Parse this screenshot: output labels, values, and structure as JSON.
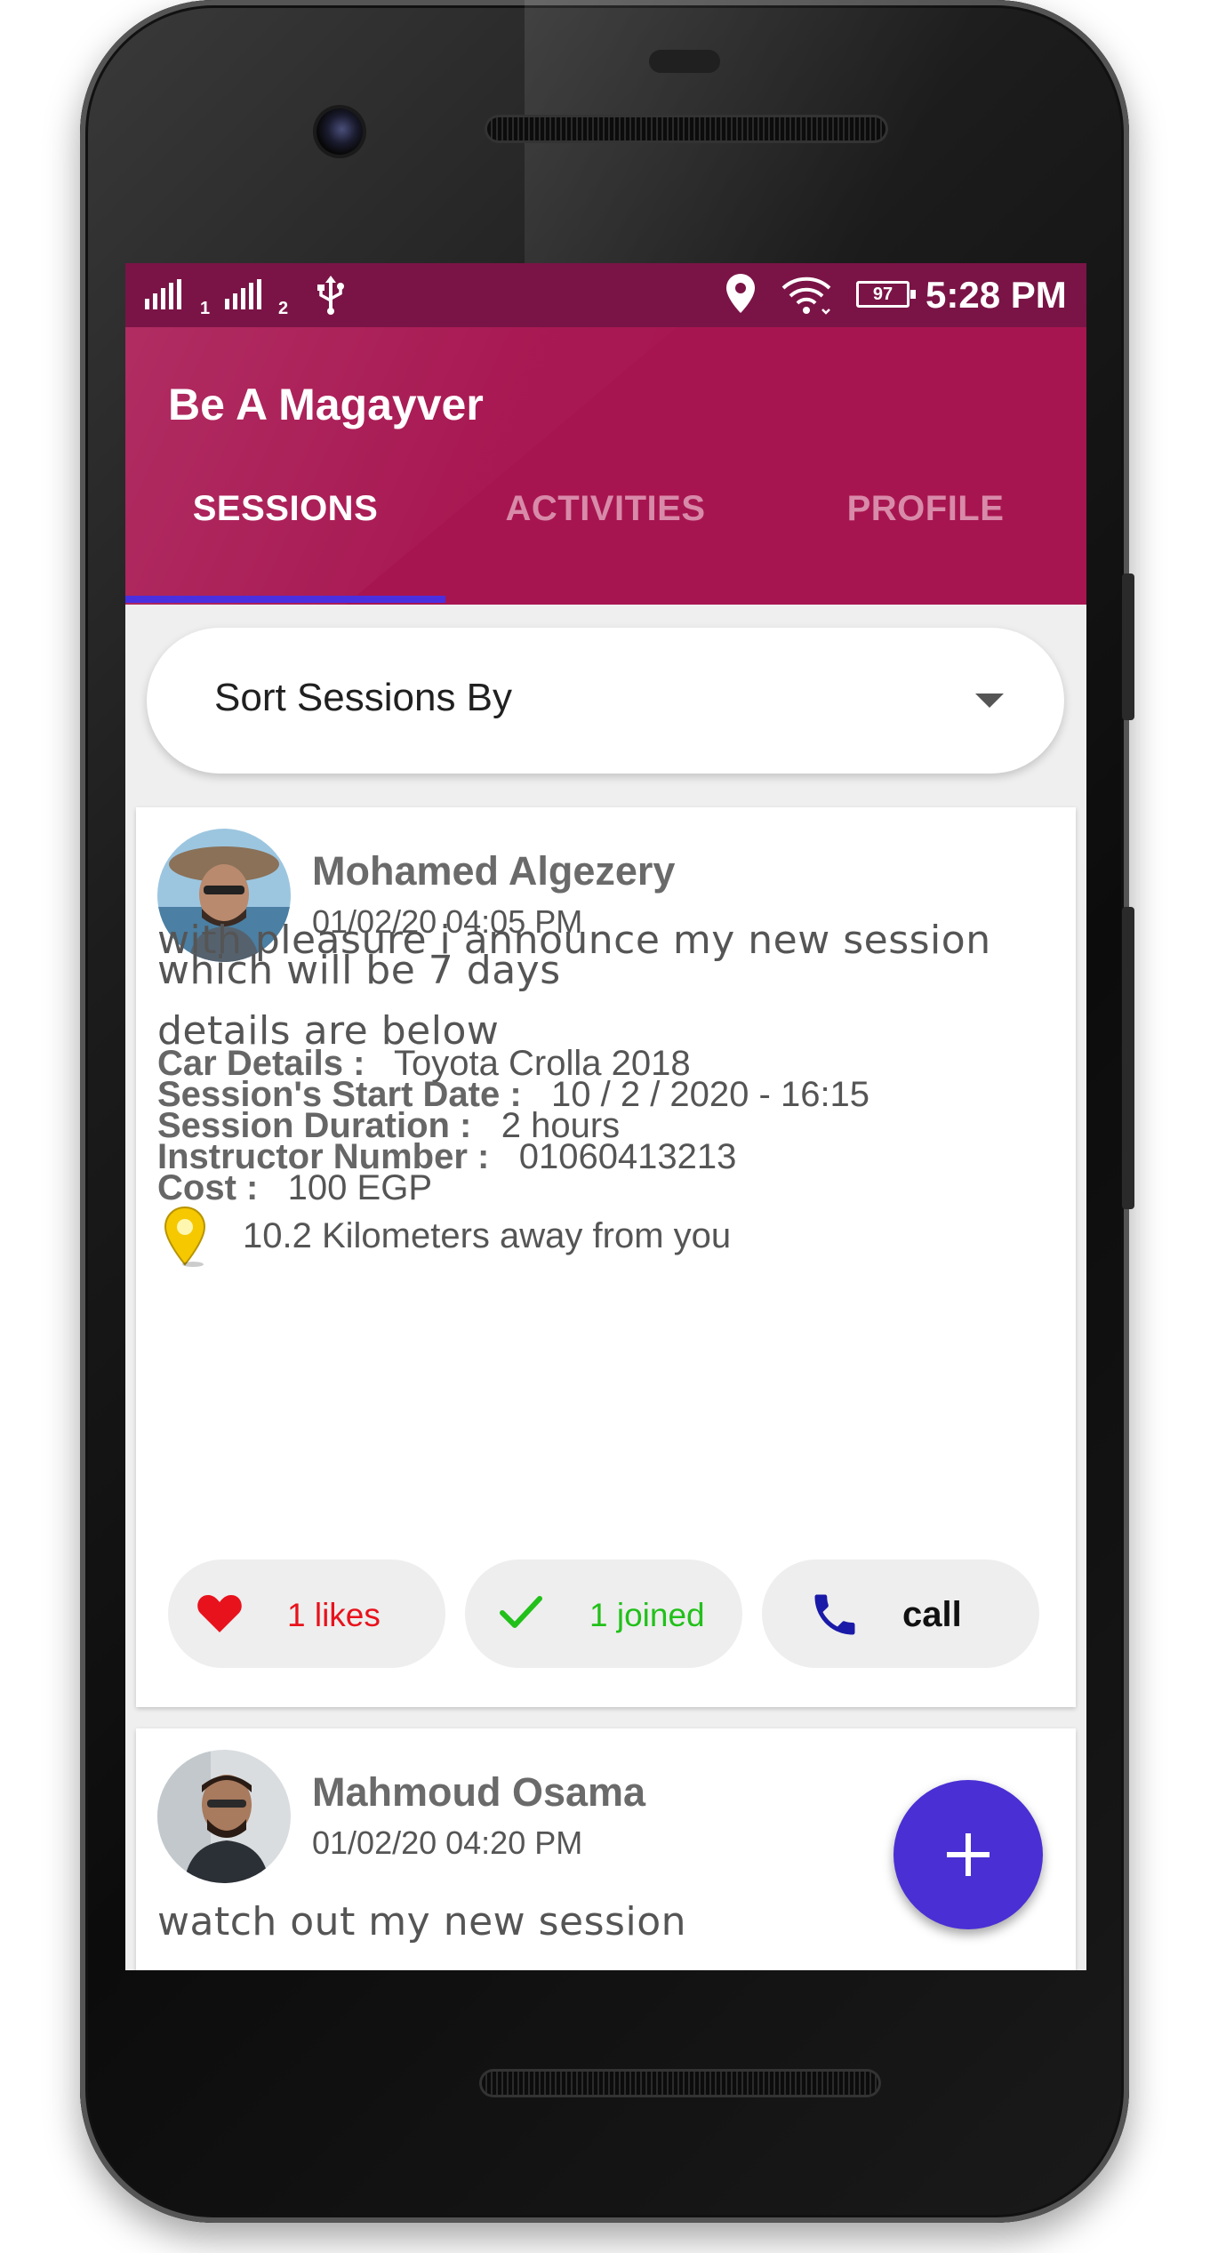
{
  "status_bar": {
    "sim1_index": "1",
    "sim2_index": "2",
    "battery": "97",
    "time": "5:28 PM"
  },
  "app": {
    "title": "Be A Magayver"
  },
  "tabs": [
    {
      "label": "SESSIONS",
      "active": true
    },
    {
      "label": "ACTIVITIES",
      "active": false
    },
    {
      "label": "PROFILE",
      "active": false
    }
  ],
  "sort": {
    "label": "Sort Sessions By"
  },
  "posts": [
    {
      "author": "Mohamed Algezery",
      "date": "01/02/20 04:05 PM",
      "body_line1": "with pleasure i announce my new session",
      "body_line2": "which will be 7 days",
      "body_line3": "details are below",
      "details": [
        {
          "label": "Car Details :",
          "value": "Toyota Crolla 2018"
        },
        {
          "label": "Session's Start Date :",
          "value": "10 / 2 / 2020 - 16:15"
        },
        {
          "label": "Session Duration :",
          "value": "2 hours"
        },
        {
          "label": "Instructor Number :",
          "value": "01060413213"
        },
        {
          "label": "Cost :",
          "value": "100 EGP"
        }
      ],
      "distance": "10.2 Kilometers away from you",
      "likes_label": "1 likes",
      "joined_label": "1 joined",
      "call_label": "call"
    },
    {
      "author": "Mahmoud Osama",
      "date": "01/02/20 04:20 PM",
      "body_line1": "watch out my new session"
    }
  ],
  "colors": {
    "primary": "#a71550",
    "status_bar": "#7a1446",
    "tab_indicator": "#4a2fe0",
    "fab": "#4a2fd4",
    "like_red": "#e8121c",
    "joined_green": "#22c01a",
    "call_blue": "#1a1aa8"
  },
  "icons": {
    "signal": "signal-icon",
    "usb": "usb-icon",
    "location": "location-pin-icon",
    "wifi": "wifi-icon",
    "battery": "battery-icon",
    "dropdown": "dropdown-arrow-icon",
    "map_pin": "map-pin-icon",
    "heart": "heart-icon",
    "check": "check-icon",
    "phone": "phone-icon",
    "add": "plus-icon"
  }
}
